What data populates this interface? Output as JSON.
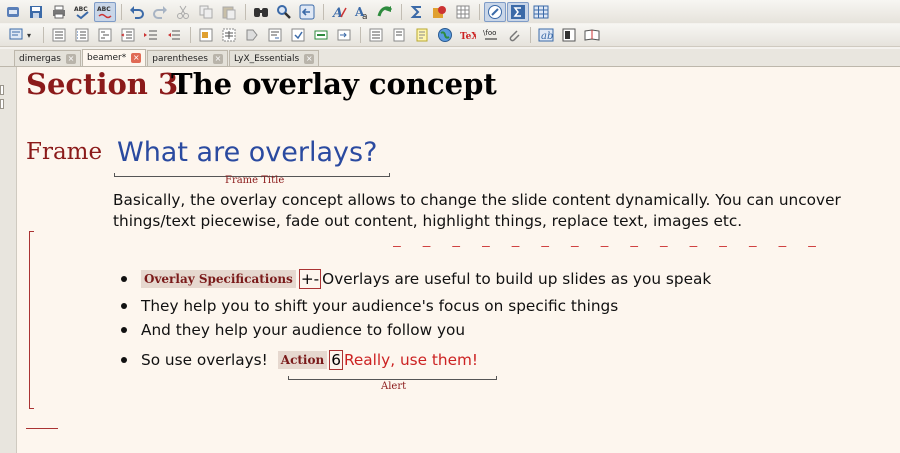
{
  "toolbar_row1": [
    "new-document-icon",
    "save-icon",
    "print-icon",
    "spellcheck-icon",
    "spellcheck-continuous-icon",
    "undo-icon",
    "redo-icon",
    "cut-icon",
    "copy-icon",
    "paste-icon",
    "find-icon",
    "find-replace-icon",
    "navigate-back-icon",
    "text-style-icon",
    "font-icon",
    "change-tracking-icon",
    "math-sum-icon",
    "insert-graphics-icon",
    "table-icon",
    "view-source-icon",
    "math-panel-icon",
    "matrix-icon"
  ],
  "toolbar_row2": [
    "layout-icon",
    "list-bullet-icon",
    "list-numbered-icon",
    "description-icon",
    "decrease-depth-icon",
    "increase-depth-icon",
    "indent-icon",
    "insert-figure-icon",
    "insert-table-float-icon",
    "insert-label-icon",
    "insert-reference-icon",
    "insert-citation-icon",
    "insert-index-icon",
    "insert-footnote-icon",
    "insert-margin-note-icon",
    "insert-note-icon",
    "insert-url-icon",
    "insert-tex-code-icon",
    "insert-math-macro-icon",
    "attach-icon",
    "insert-box-icon",
    "toc-icon",
    "outline-icon"
  ],
  "tabs": [
    {
      "label": "dimergas",
      "active": false
    },
    {
      "label": "beamer*",
      "active": true
    },
    {
      "label": "parentheses",
      "active": false
    },
    {
      "label": "LyX_Essentials",
      "active": false
    }
  ],
  "document": {
    "section_number": "Section 3",
    "section_title": "The overlay concept",
    "frame_label": "Frame",
    "frame_title": "What are overlays?",
    "frame_title_caption": "Frame Title",
    "paragraph": "Basically, the overlay concept allows to change the slide content dynamically. You can uncover things/text piecewise, fade out content, highlight things, replace text, images etc.",
    "items": [
      {
        "overlay_spec": "Overlay Specifications",
        "overlay_value": "+-",
        "text": "Overlays are useful to build up slides as you speak"
      },
      {
        "text": "They help you to shift your audience's focus on specific things"
      },
      {
        "text": "And they help your audience to follow you"
      },
      {
        "text": "So use overlays!",
        "action": "Action",
        "action_value": "6",
        "alert_text": "Really, use them!"
      }
    ],
    "alert_caption": "Alert"
  },
  "colors": {
    "section_red": "#8b1a1a",
    "frame_title_blue": "#2a4aa0",
    "alert_red": "#cc2222",
    "document_background": "#fdf6ee"
  }
}
